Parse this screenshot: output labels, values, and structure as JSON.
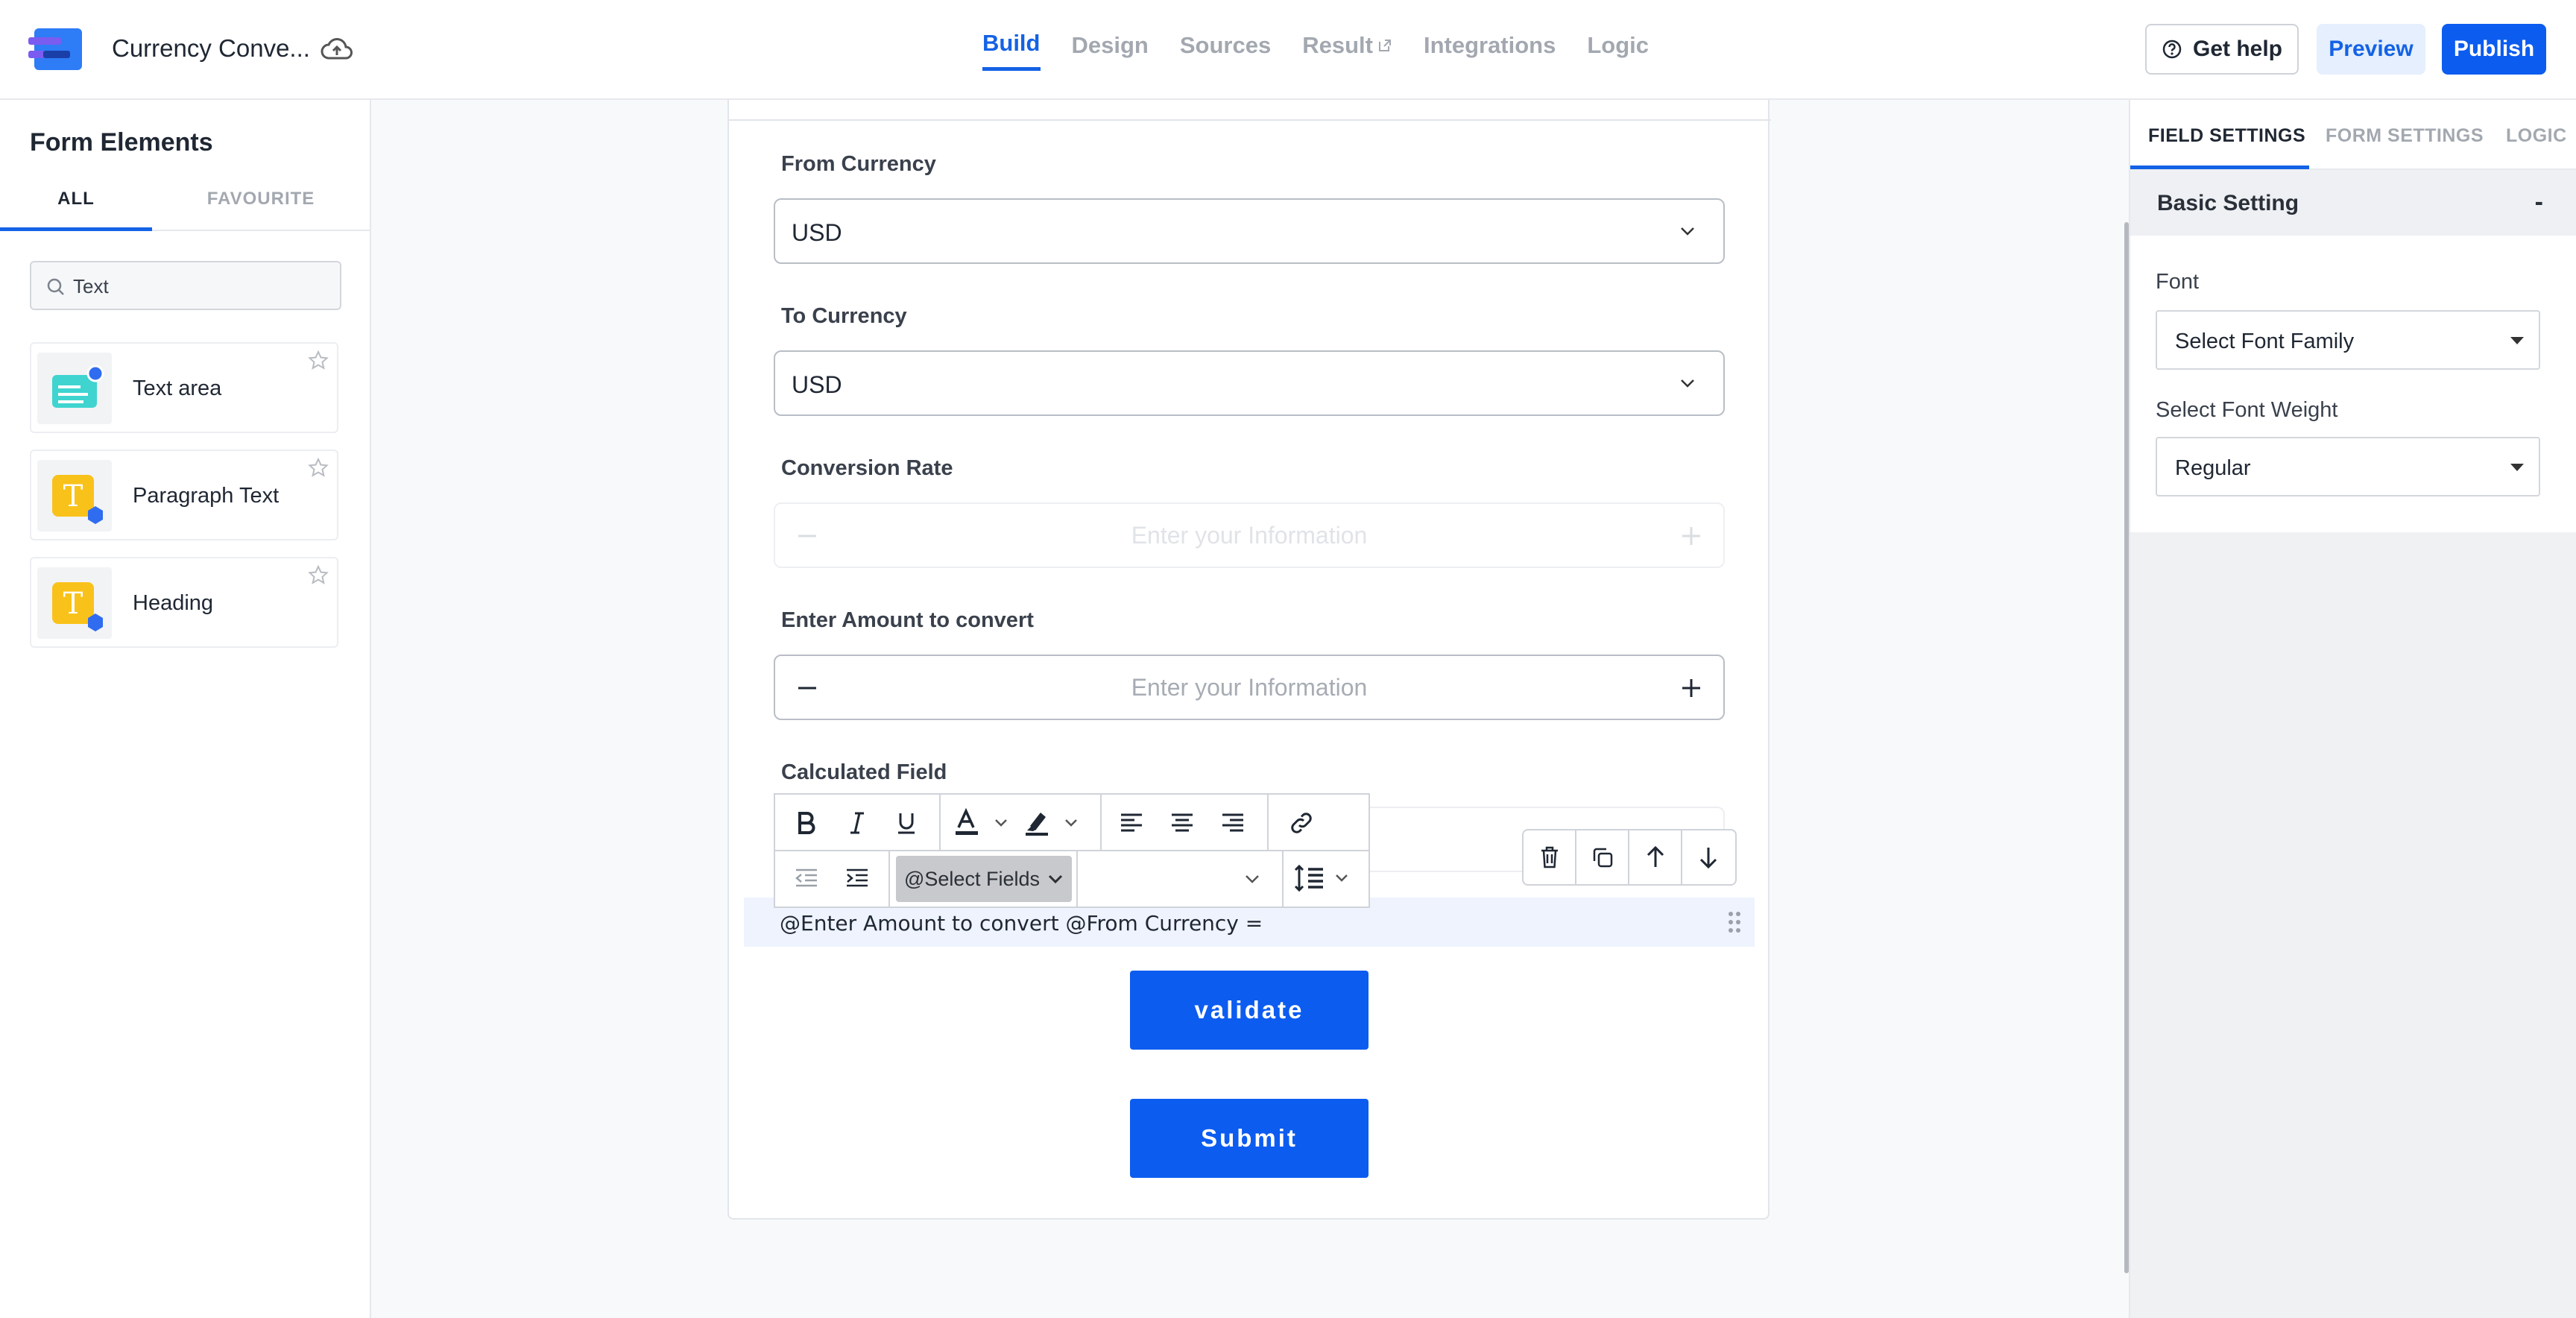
{
  "header": {
    "app_title": "Currency Conve...",
    "nav_tabs": [
      {
        "label": "Build",
        "active": true
      },
      {
        "label": "Design"
      },
      {
        "label": "Sources"
      },
      {
        "label": "Result"
      },
      {
        "label": "Integrations"
      },
      {
        "label": "Logic"
      }
    ],
    "get_help": "Get help",
    "preview": "Preview",
    "publish": "Publish"
  },
  "left_panel": {
    "title": "Form Elements",
    "tabs": [
      "ALL",
      "FAVOURITE"
    ],
    "search_value": "Text",
    "elements": [
      "Text area",
      "Paragraph Text",
      "Heading"
    ]
  },
  "form": {
    "from_currency": {
      "label": "From Currency",
      "value": "USD"
    },
    "to_currency": {
      "label": "To Currency",
      "value": "USD"
    },
    "conversion_rate": {
      "label": "Conversion Rate",
      "placeholder": "Enter your Information"
    },
    "amount": {
      "label": "Enter Amount to convert",
      "placeholder": "Enter your Information"
    },
    "calculated": {
      "label": "Calculated Field"
    },
    "toolbar": {
      "select_fields": "@Select Fields"
    },
    "formula": "@Enter Amount to convert  @From Currency =",
    "validate": "validate",
    "submit": "Submit"
  },
  "right_panel": {
    "tabs": [
      "FIELD SETTINGS",
      "FORM SETTINGS",
      "LOGIC"
    ],
    "section_title": "Basic Setting",
    "collapse": "-",
    "font_label": "Font",
    "font_value": "Select Font Family",
    "weight_label": "Select Font Weight",
    "weight_value": "Regular"
  },
  "colors": {
    "accent": "#0c5cf0",
    "nav_active": "#1462e6"
  }
}
